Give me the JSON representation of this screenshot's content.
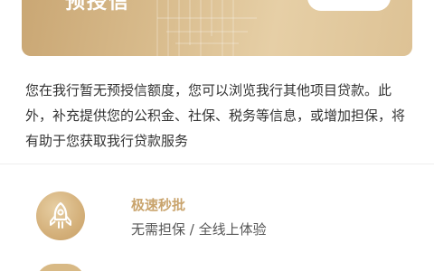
{
  "card": {
    "title": "预授信",
    "colors": {
      "gold_light": "#e6cfa6",
      "gold_dark": "#c9a673"
    }
  },
  "info": {
    "text": "您在我行暂无预授信额度，您可以浏览我行其他项目贷款。此外，补充提供您的公积金、社保、税务等信息，或增加担保，将有助于您获取我行贷款服务"
  },
  "features": [
    {
      "icon": "rocket-icon",
      "title": "极速秒批",
      "desc": "无需担保 / 全线上体验"
    }
  ],
  "theme": {
    "accent": "#c9a46d",
    "text_primary": "#333333",
    "text_secondary": "#555555"
  }
}
